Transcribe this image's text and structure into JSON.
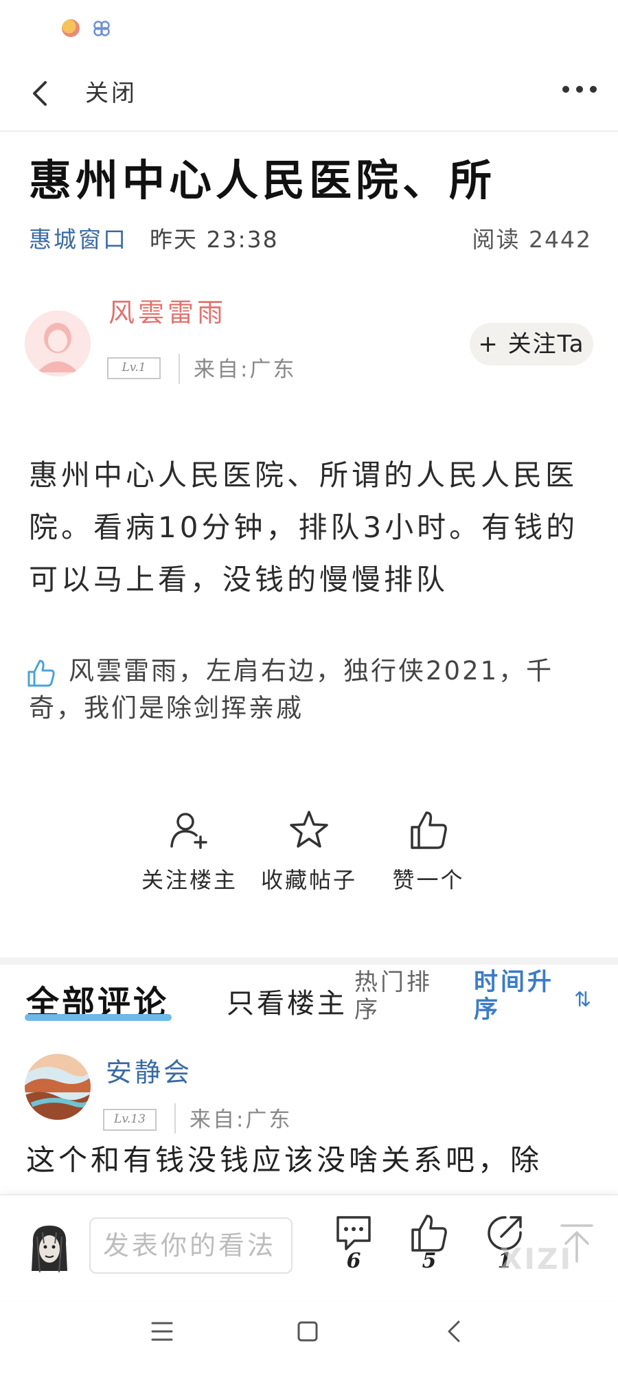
{
  "nav": {
    "close_label": "关闭"
  },
  "post": {
    "title": "惠州中心人民医院、所",
    "section": "惠城窗口",
    "time": "昨天 23:38",
    "reads": "阅读 2442",
    "author": {
      "name": "风雲雷雨",
      "level": "Lv.1",
      "origin": "来自:广东",
      "follow_label": "+ 关注Ta"
    },
    "body": "惠州中心人民医院、所谓的人民人民医院。看病10分钟，排队3小时。有钱的可以马上看，没钱的慢慢排队",
    "likers": "风雲雷雨，左肩右边，独行侠2021，千奇，我们是除剑挥亲戚"
  },
  "actions": {
    "follow_owner": "关注楼主",
    "favorite": "收藏帖子",
    "like": "赞一个"
  },
  "comment_tabs": {
    "all": "全部评论",
    "owner_only": "只看楼主",
    "hot": "热门排序",
    "time": "时间升序",
    "sort_icon": "⇅"
  },
  "comment": {
    "name": "安静会",
    "level": "Lv.13",
    "origin": "来自:广东",
    "text": "这个和有钱没钱应该没啥关系吧，除"
  },
  "bottom_bar": {
    "input_placeholder": "发表你的看法",
    "comment_count": "6",
    "like_count": "5",
    "share_count": "1",
    "watermark": "XIZI"
  },
  "colors": {
    "section": "#3a6aa3",
    "author_name": "#e0736e",
    "accent_tab": "#3a7cc8",
    "tab_underline": "#6fb8ea"
  }
}
